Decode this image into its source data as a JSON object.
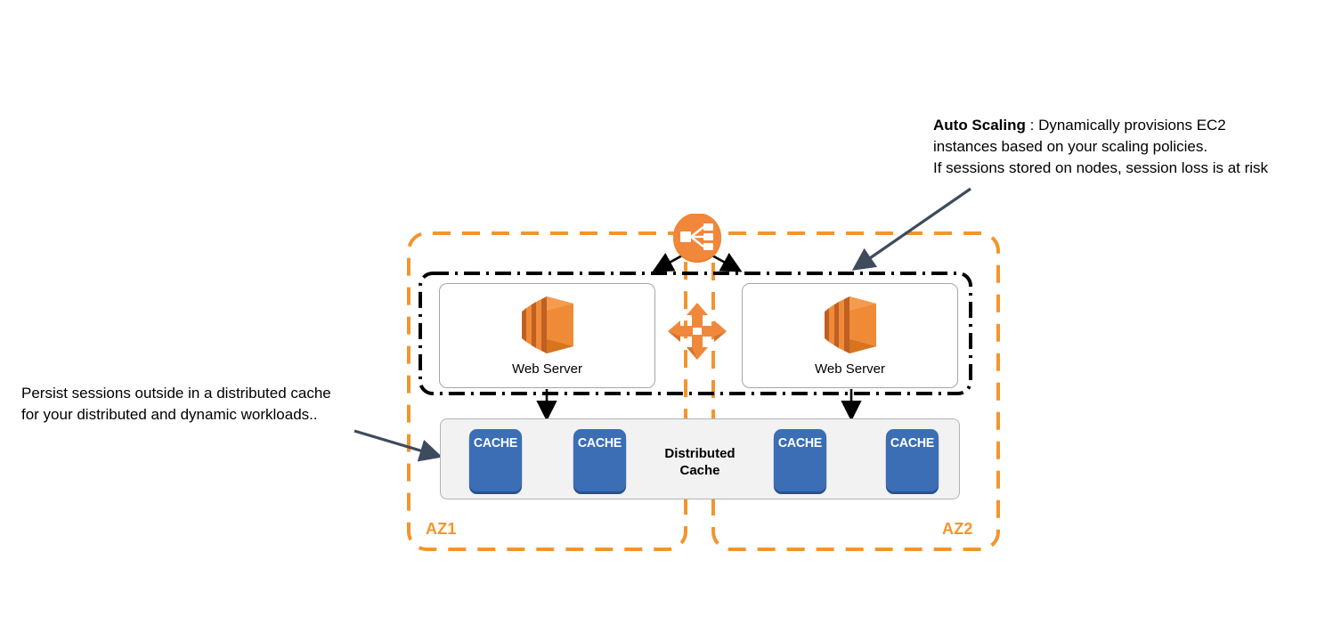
{
  "diagram": {
    "title": "AWS multi-AZ web tier with distributed session cache",
    "colors": {
      "aws_orange": "#f2952e",
      "ec2_orange": "#ee8c33",
      "cache_blue": "#3b6eb5",
      "cache_blue_shadow": "#2b5289",
      "annotation_arrow": "#3d4b5c",
      "asg_border": "#000000",
      "band_fill": "#f2f2f2",
      "band_border": "#b3b3b3",
      "card_border": "#a6a6a6"
    }
  },
  "annotations": {
    "auto_scaling": {
      "lead": "Auto Scaling",
      "line1_rest": " : Dynamically provisions EC2",
      "line2": "instances based on your scaling policies.",
      "line3": "If sessions stored on nodes, session loss is at risk"
    },
    "persist": {
      "line1": "Persist sessions outside in a distributed cache",
      "line2": "for your distributed and dynamic workloads.."
    }
  },
  "availability_zones": [
    {
      "id": "az1",
      "label": "AZ1"
    },
    {
      "id": "az2",
      "label": "AZ2"
    }
  ],
  "load_balancer": {
    "icon": "elastic-load-balancer-icon"
  },
  "replication": {
    "icon": "multi-directional-arrows-icon"
  },
  "auto_scaling_group": {
    "icon": "auto-scaling-group-boundary"
  },
  "servers": [
    {
      "id": "server-az1",
      "label": "Web Server",
      "icon": "ec2-instances-icon"
    },
    {
      "id": "server-az2",
      "label": "Web Server",
      "icon": "ec2-instances-icon"
    }
  ],
  "distributed_cache": {
    "title_line1": "Distributed",
    "title_line2": "Cache",
    "nodes": [
      {
        "id": "cache-node-1",
        "label": "CACHE"
      },
      {
        "id": "cache-node-2",
        "label": "CACHE"
      },
      {
        "id": "cache-node-3",
        "label": "CACHE"
      },
      {
        "id": "cache-node-4",
        "label": "CACHE"
      }
    ]
  }
}
